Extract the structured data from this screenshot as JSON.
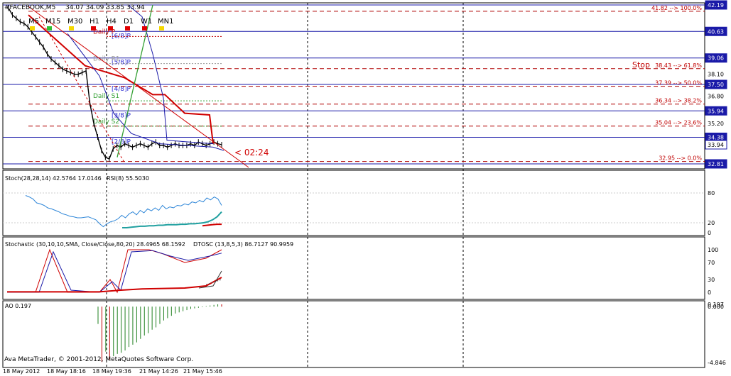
{
  "chart_data": {
    "type": "line",
    "title": "#FACEBOOK,M5",
    "symbol": "#FACEBOOK",
    "timeframe": "M5",
    "ohlc_header": "34.07 34.09 33.85 33.94",
    "timeframes": [
      {
        "label": "M5",
        "color": "#f5d800"
      },
      {
        "label": "M15",
        "color": "#33c233"
      },
      {
        "label": "M30",
        "color": "#f5d800"
      },
      {
        "label": "H1",
        "color": "#e00000"
      },
      {
        "label": "H4",
        "color": "#e00000"
      },
      {
        "label": "D1",
        "color": "#e00000"
      },
      {
        "label": "W1",
        "color": "#e00000"
      },
      {
        "label": "MN1",
        "color": "#f5d800"
      }
    ],
    "price_axis": {
      "min": 32.81,
      "max": 42.19,
      "ticks": [
        "38.10",
        "37.50",
        "36.80",
        "35.94",
        "35.20",
        "34.38",
        "33.94",
        "32.81"
      ],
      "boxed": [
        {
          "value": "42.19",
          "level": 42.19
        },
        {
          "value": "40.63",
          "level": 40.63
        },
        {
          "value": "39.06",
          "level": 39.06
        },
        {
          "value": "37.50",
          "level": 37.5
        },
        {
          "value": "35.94",
          "level": 35.94
        },
        {
          "value": "34.38",
          "level": 34.38
        },
        {
          "value": "33.94",
          "level": 33.94,
          "current": true
        },
        {
          "value": "32.81",
          "level": 32.81
        }
      ],
      "label_39_06": "39.06"
    },
    "murrey_levels": [
      {
        "label": "[6/8]P",
        "price": 40.63
      },
      {
        "label": "[5/8]P",
        "price": 39.06
      },
      {
        "label": "[4/8]P",
        "price": 37.5
      },
      {
        "label": "[3/8]P",
        "price": 35.94
      },
      {
        "label": "[2/8]P",
        "price": 34.38
      }
    ],
    "pivot_labels": [
      {
        "label": "Daily P",
        "price": 40.5
      },
      {
        "label": "Daily R1",
        "price": 38.9
      },
      {
        "label": "Daily S1",
        "price": 36.7
      },
      {
        "label": "Daily S2",
        "price": 35.2
      }
    ],
    "fibo_levels": [
      {
        "label": "41.82 --> 100.0%",
        "price": 41.82
      },
      {
        "label": "38.43 --> 61.8%",
        "price": 38.43,
        "prefix": "Stop"
      },
      {
        "label": "37.39 --> 50.0%",
        "price": 37.39
      },
      {
        "label": "36.34 --> 38.2%",
        "price": 36.34
      },
      {
        "label": "35.04 --> 23.6%",
        "price": 35.04
      },
      {
        "label": "32.95 --> 0.0%",
        "price": 32.95
      }
    ],
    "countdown": "< 02:24",
    "price_series": [
      42.0,
      41.6,
      41.4,
      41.2,
      41.1,
      40.9,
      40.6,
      40.3,
      40.0,
      39.7,
      39.3,
      39.0,
      38.8,
      38.6,
      38.4,
      38.3,
      38.2,
      38.1,
      38.1,
      38.2,
      38.3,
      36.4,
      35.2,
      34.4,
      33.6,
      33.2,
      33.1,
      33.7,
      33.9,
      33.8,
      34.0,
      33.9,
      33.8,
      33.9,
      34.0,
      33.9,
      33.8,
      34.0,
      34.1,
      33.9,
      33.9,
      33.8,
      33.9,
      34.0,
      33.9,
      33.9,
      33.9,
      34.0,
      33.9,
      34.1,
      34.0,
      33.9,
      34.0,
      34.1,
      34.0,
      33.94
    ],
    "stoch_panel": {
      "label": "Stoch(28,28,14) 42.5764 17.0146",
      "rsi_label": "RSI(8) 55.5030",
      "ticks": [
        "80",
        "20",
        "0"
      ],
      "rsi_values": [
        75,
        72,
        68,
        60,
        58,
        55,
        50,
        48,
        45,
        42,
        38,
        36,
        33,
        32,
        30,
        30,
        31,
        32,
        29,
        26,
        18,
        12,
        18,
        22,
        24,
        28,
        35,
        30,
        38,
        42,
        36,
        45,
        40,
        48,
        44,
        50,
        45,
        55,
        48,
        52,
        50,
        55,
        54,
        58,
        56,
        62,
        60,
        65,
        62,
        70,
        66,
        72,
        68,
        55
      ],
      "stoch_main": [
        10,
        10,
        11,
        12,
        13,
        13,
        14,
        14,
        15,
        15,
        16,
        16,
        16,
        17,
        17,
        18,
        18,
        19,
        20,
        22,
        26,
        32,
        42
      ],
      "stoch_signal": [
        14,
        15,
        16,
        17,
        17
      ]
    },
    "dtosc_panel": {
      "label": "Stochastic (30,10,10,SMA, Close/Close,80,20) 28.4965 68.1592",
      "dtosc_label": "DTOSC (13,8,5,3) 86.7127 90.9959",
      "ticks": [
        "100",
        "70",
        "30",
        "0"
      ]
    },
    "ao_panel": {
      "label": "AO 0.197",
      "ticks": [
        "0.197",
        "0.000",
        "-4.846"
      ],
      "values": [
        -1.5,
        -4.8,
        -3.9,
        -4.6,
        -4.3,
        -4.1,
        -4.0,
        -3.8,
        -3.5,
        -3.3,
        -3.1,
        -2.8,
        -2.5,
        -2.3,
        -2.0,
        -1.8,
        -1.5,
        -1.2,
        -1.0,
        -0.8,
        -0.6,
        -0.5,
        -0.4,
        -0.3,
        -0.2,
        -0.15,
        -0.1,
        -0.05,
        0.05,
        0.1,
        0.15,
        0.2,
        0.197
      ]
    },
    "time_axis": [
      "18 May 2012",
      "18 May 18:16",
      "18 May 19:36",
      "21 May 14:26",
      "21 May 15:46"
    ],
    "copyright": "Ava MetaTrader, © 2001-2012, MetaQuotes Software Corp."
  }
}
